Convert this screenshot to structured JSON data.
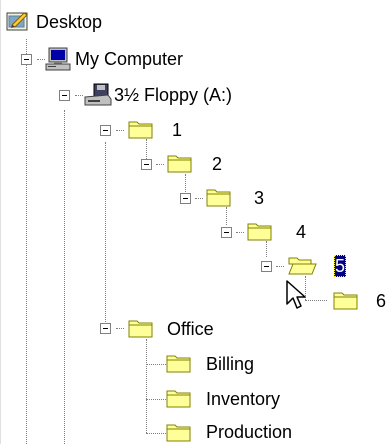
{
  "tree": {
    "root": {
      "label": "Desktop",
      "icon": "desktop-icon"
    },
    "my_computer": {
      "label": "My Computer",
      "icon": "computer-icon"
    },
    "floppy": {
      "label": "3½ Floppy (A:)",
      "icon": "floppy-drive-icon"
    },
    "folders": {
      "f1": "1",
      "f2": "2",
      "f3": "3",
      "f4": "4",
      "f5": "5",
      "f6": "6",
      "office": "Office",
      "billing": "Billing",
      "inventory": "Inventory",
      "production": "Production"
    },
    "selected_folder": "5",
    "colors": {
      "selection": "#000080",
      "folder": "#ffff99",
      "folder_edge": "#808000"
    },
    "cursor": "arrow-pointer-icon"
  }
}
